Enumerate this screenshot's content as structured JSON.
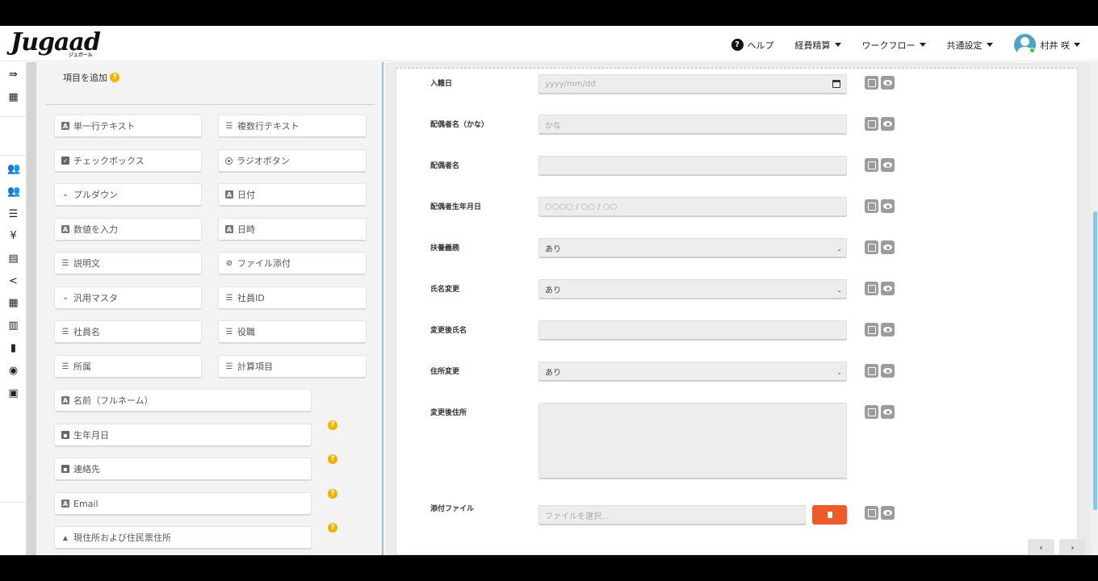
{
  "header": {
    "logo": "Jugaad",
    "logo_sub": "ジュガール",
    "help_icon": "?",
    "help": "ヘルプ",
    "menu_expense": "経費精算",
    "menu_workflow": "ワークフロー",
    "menu_common": "共通設定",
    "user_name": "村井 咲"
  },
  "rail": {
    "icons": [
      "collapse-arrow-icon",
      "building-icon",
      "users-icon",
      "users-alt-icon",
      "list-icon",
      "yen-icon",
      "document-list-icon",
      "share-icon",
      "table-icon",
      "books-icon",
      "file-icon",
      "globe-icon",
      "wallet-icon"
    ],
    "glyphs": [
      "⇛",
      "▦",
      "👥",
      "👥",
      "☰",
      "¥",
      "▤",
      "<",
      "▦",
      "▥",
      "▮",
      "◉",
      "▣"
    ]
  },
  "palette": {
    "title": "項目を追加",
    "q": "?",
    "tiles": [
      {
        "label": "単一行テキスト",
        "glyph": "A"
      },
      {
        "label": "複数行テキスト",
        "glyph": "☰"
      },
      {
        "label": "チェックボックス",
        "glyph": "✓"
      },
      {
        "label": "ラジオボタン",
        "glyph": ""
      },
      {
        "label": "プルダウン",
        "glyph": "⌄"
      },
      {
        "label": "日付",
        "glyph": "A"
      },
      {
        "label": "数値を入力",
        "glyph": "A"
      },
      {
        "label": "日時",
        "glyph": "A"
      },
      {
        "label": "説明文",
        "glyph": "☰"
      },
      {
        "label": "ファイル添付",
        "glyph": "⊘"
      },
      {
        "label": "汎用マスタ",
        "glyph": "⌄"
      },
      {
        "label": "社員ID",
        "glyph": "☰"
      },
      {
        "label": "社員名",
        "glyph": "☰"
      },
      {
        "label": "役職",
        "glyph": "☰"
      },
      {
        "label": "所属",
        "glyph": "☰"
      },
      {
        "label": "計算項目",
        "glyph": "☰"
      }
    ],
    "wide_tiles": [
      {
        "label": "名前（フルネーム）",
        "glyph": "A"
      },
      {
        "label": "生年月日",
        "glyph": "▪"
      },
      {
        "label": "連絡先",
        "glyph": "▪"
      },
      {
        "label": "Email",
        "glyph": "A"
      },
      {
        "label": "現住所および住民票住所",
        "glyph": "▲"
      }
    ]
  },
  "form": {
    "fields": [
      {
        "label": "入籍日",
        "placeholder": "yyyy/mm/dd"
      },
      {
        "label": "配偶者名（かな）",
        "placeholder": "かな"
      },
      {
        "label": "配偶者名",
        "placeholder": ""
      },
      {
        "label": "配偶者生年月日",
        "placeholder": "○○○○ / ○○ / ○○"
      },
      {
        "label": "扶養義務",
        "value": "あり"
      },
      {
        "label": "氏名変更",
        "value": "あり"
      },
      {
        "label": "変更後氏名",
        "placeholder": ""
      },
      {
        "label": "住所変更",
        "value": "あり"
      },
      {
        "label": "変更後住所",
        "placeholder": ""
      },
      {
        "label": "添付ファイル",
        "placeholder": "ファイルを選択..."
      }
    ]
  },
  "pager": {
    "prev": "‹",
    "next": "›"
  }
}
